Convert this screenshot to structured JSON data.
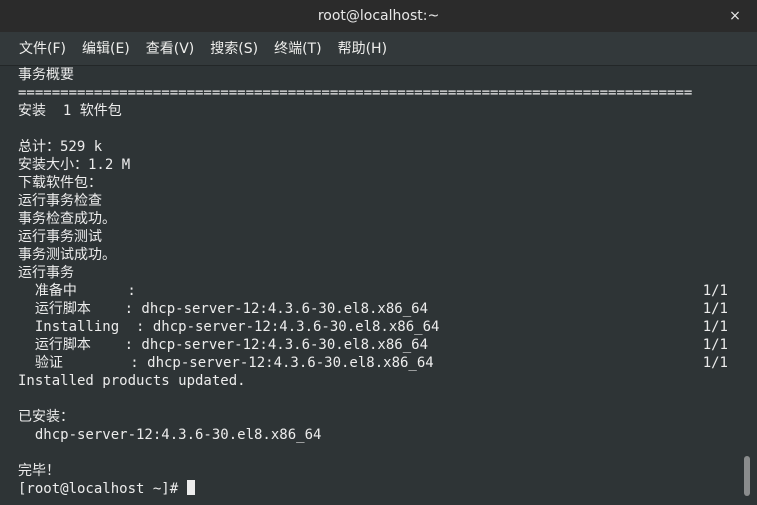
{
  "window": {
    "title": "root@localhost:~",
    "close_glyph": "×"
  },
  "menu": [
    {
      "label": "文件(F)"
    },
    {
      "label": "编辑(E)"
    },
    {
      "label": "查看(V)"
    },
    {
      "label": "搜索(S)"
    },
    {
      "label": "终端(T)"
    },
    {
      "label": "帮助(H)"
    }
  ],
  "terminal": {
    "lines": [
      {
        "text": "事务概要"
      },
      {
        "text": "================================================================================"
      },
      {
        "text": "安装  1 软件包"
      },
      {
        "text": ""
      },
      {
        "text": "总计：529 k"
      },
      {
        "text": "安装大小：1.2 M"
      },
      {
        "text": "下载软件包："
      },
      {
        "text": "运行事务检查"
      },
      {
        "text": "事务检查成功。"
      },
      {
        "text": "运行事务测试"
      },
      {
        "text": "事务测试成功。"
      },
      {
        "text": "运行事务"
      },
      {
        "text": "  准备中      :",
        "right": "1/1"
      },
      {
        "text": "  运行脚本    : dhcp-server-12:4.3.6-30.el8.x86_64",
        "right": "1/1"
      },
      {
        "text": "  Installing  : dhcp-server-12:4.3.6-30.el8.x86_64",
        "right": "1/1"
      },
      {
        "text": "  运行脚本    : dhcp-server-12:4.3.6-30.el8.x86_64",
        "right": "1/1"
      },
      {
        "text": "  验证        : dhcp-server-12:4.3.6-30.el8.x86_64",
        "right": "1/1"
      },
      {
        "text": "Installed products updated."
      },
      {
        "text": ""
      },
      {
        "text": "已安装："
      },
      {
        "text": "  dhcp-server-12:4.3.6-30.el8.x86_64"
      },
      {
        "text": ""
      },
      {
        "text": "完毕！"
      }
    ],
    "prompt": "[root@localhost ~]# "
  },
  "colors": {
    "background": "#2e3436",
    "text": "#ececec",
    "titlebar": "#2b2b2b"
  }
}
